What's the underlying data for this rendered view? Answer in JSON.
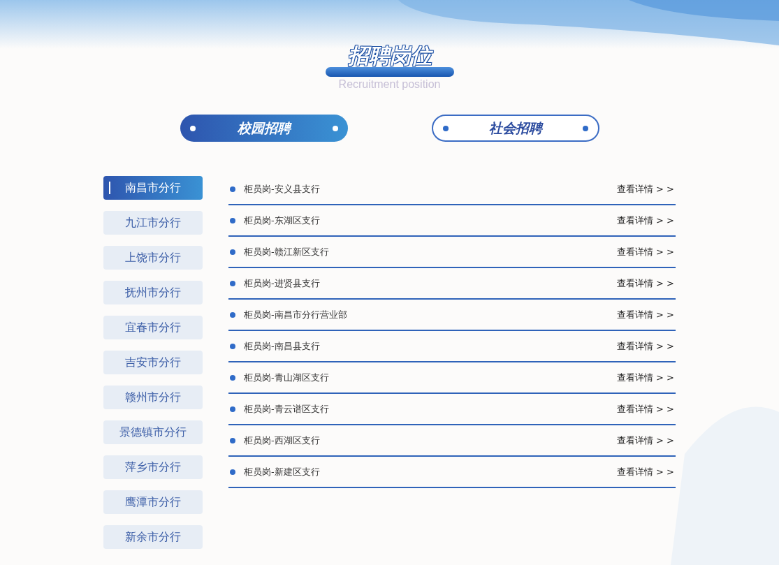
{
  "heading": {
    "title": "招聘岗位",
    "subtitle": "Recruitment position"
  },
  "tabs": [
    {
      "label": "校园招聘",
      "selected": true
    },
    {
      "label": "社会招聘",
      "selected": false
    }
  ],
  "branches": [
    {
      "label": "南昌市分行",
      "selected": true
    },
    {
      "label": "九江市分行",
      "selected": false
    },
    {
      "label": "上饶市分行",
      "selected": false
    },
    {
      "label": "抚州市分行",
      "selected": false
    },
    {
      "label": "宜春市分行",
      "selected": false
    },
    {
      "label": "吉安市分行",
      "selected": false
    },
    {
      "label": "赣州市分行",
      "selected": false
    },
    {
      "label": "景德镇市分行",
      "selected": false
    },
    {
      "label": "萍乡市分行",
      "selected": false
    },
    {
      "label": "鹰潭市分行",
      "selected": false
    },
    {
      "label": "新余市分行",
      "selected": false
    }
  ],
  "jobs": [
    {
      "title": "柜员岗-安义县支行",
      "link": "查看详情 > >"
    },
    {
      "title": "柜员岗-东湖区支行",
      "link": "查看详情 > >"
    },
    {
      "title": "柜员岗-赣江新区支行",
      "link": "查看详情 > >"
    },
    {
      "title": "柜员岗-进贤县支行",
      "link": "查看详情 > >"
    },
    {
      "title": "柜员岗-南昌市分行营业部",
      "link": "查看详情 > >"
    },
    {
      "title": "柜员岗-南昌县支行",
      "link": "查看详情 > >"
    },
    {
      "title": "柜员岗-青山湖区支行",
      "link": "查看详情 > >"
    },
    {
      "title": "柜员岗-青云谱区支行",
      "link": "查看详情 > >"
    },
    {
      "title": "柜员岗-西湖区支行",
      "link": "查看详情 > >"
    },
    {
      "title": "柜员岗-新建区支行",
      "link": "查看详情 > >"
    }
  ]
}
